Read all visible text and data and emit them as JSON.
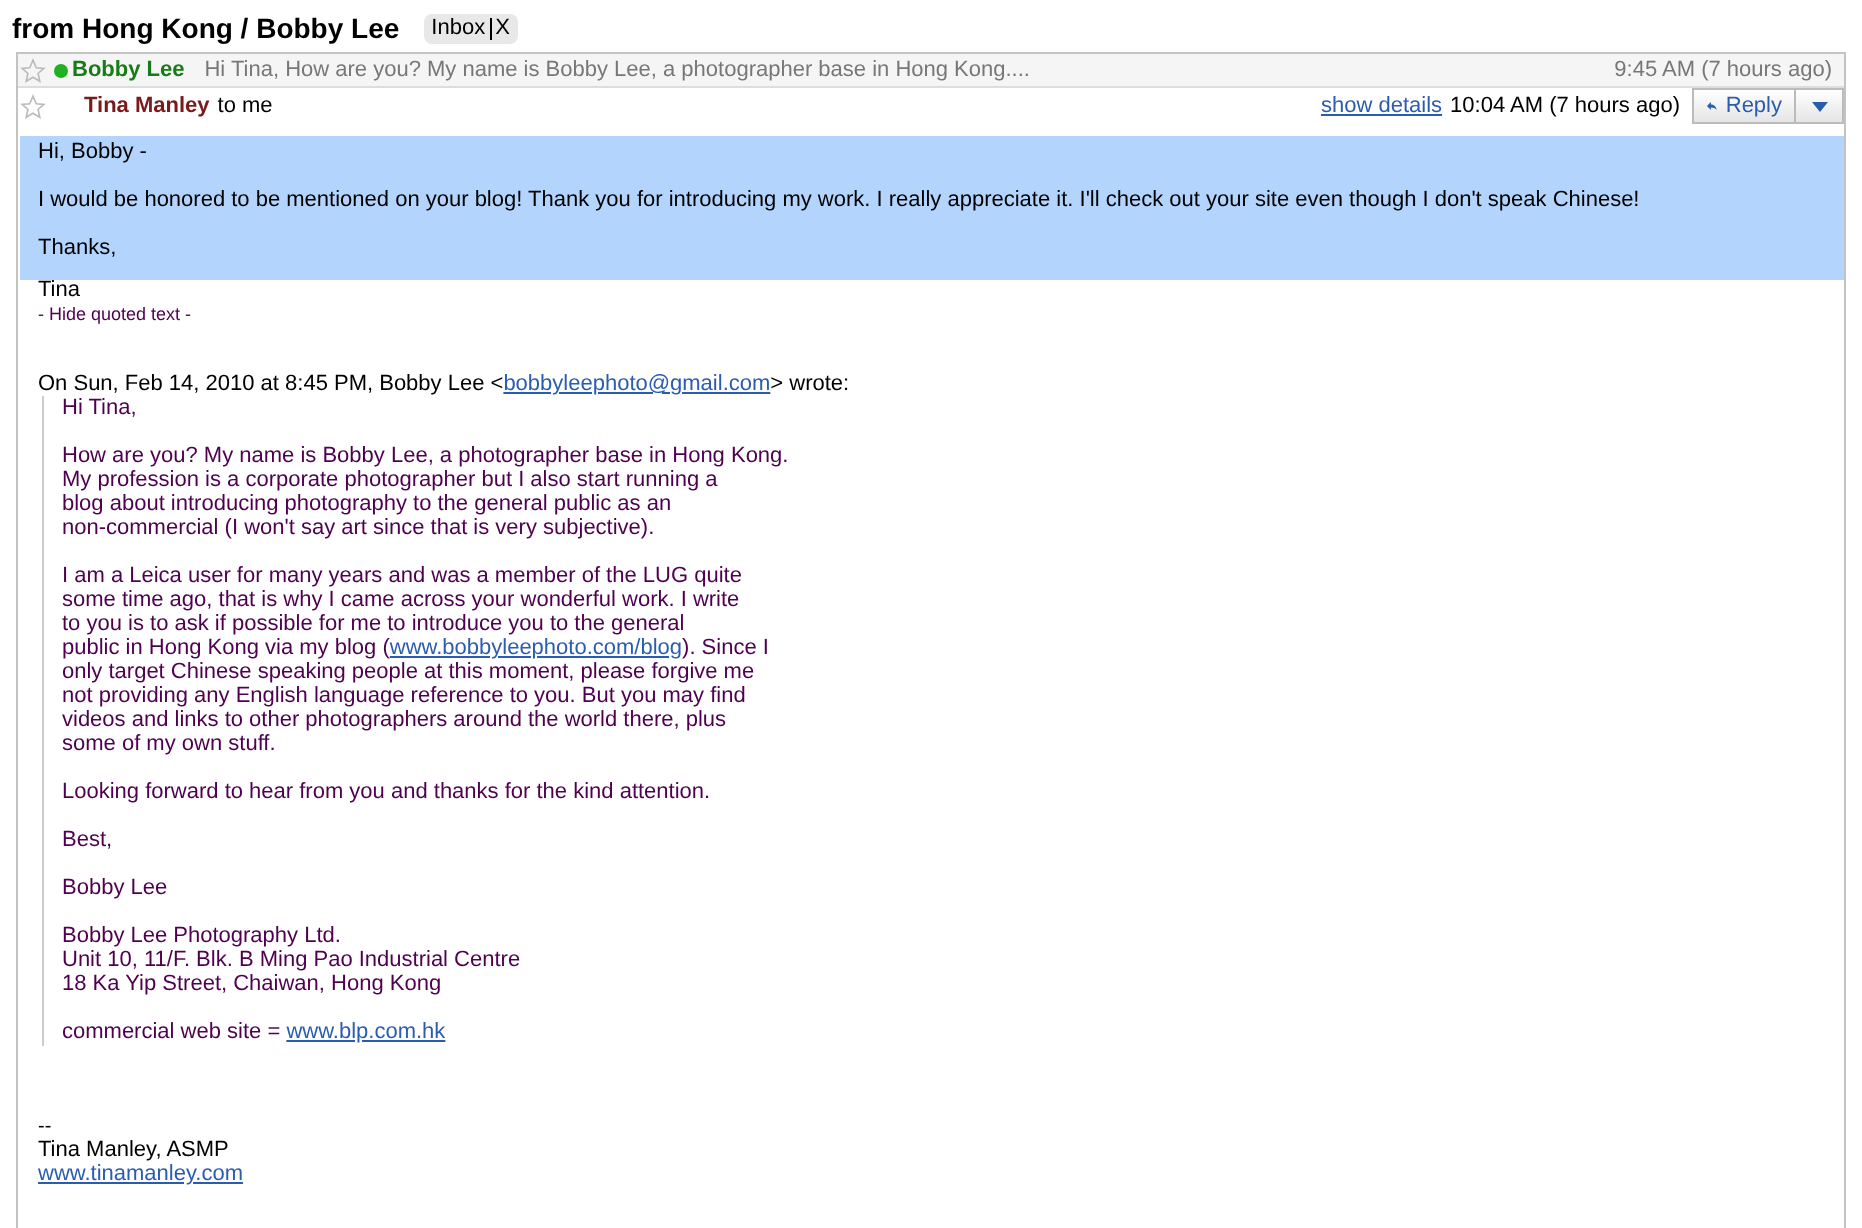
{
  "title": "from Hong Kong / Bobby Lee",
  "label": {
    "text": "Inbox",
    "remove": "X"
  },
  "collapsed_message": {
    "sender": "Bobby Lee",
    "snippet": "Hi Tina, How are you? My name is Bobby Lee, a photographer base in Hong Kong....",
    "time": "9:45 AM (7 hours ago)",
    "starred": false
  },
  "message": {
    "sender": "Tina Manley",
    "recipient": "to me",
    "show_details": "show details",
    "time": "10:04 AM (7 hours ago)",
    "reply": "Reply",
    "starred": false,
    "selected_lines": [
      "Hi, Bobby -",
      "I would be honored to be mentioned on your blog!  Thank you for introducing my work.  I really appreciate it.  I'll check out your site even though I don't speak Chinese!",
      "Thanks,"
    ],
    "signoff": "Tina",
    "hide_quoted": "- Hide quoted text -",
    "attribution": [
      {
        "text": "On Sun, Feb 14, 2010 at 8:45 PM, Bobby Lee <"
      },
      {
        "text": "bobbyleephoto@gmail.com",
        "link": true
      },
      {
        "text": "> wrote:"
      }
    ],
    "quoted_paragraphs": [
      {
        "lines": [
          [
            {
              "text": "Hi Tina,"
            }
          ]
        ]
      },
      {
        "lines": [
          [
            {
              "text": "How are you?  My name is Bobby Lee, a photographer base in Hong Kong."
            }
          ],
          [
            {
              "text": "My profession is a corporate photographer but I also start running a"
            }
          ],
          [
            {
              "text": "blog about introducing photography to the general public as an"
            }
          ],
          [
            {
              "text": "non-commercial (I won't say art since that is very subjective)."
            }
          ]
        ]
      },
      {
        "lines": [
          [
            {
              "text": "I am a Leica user for many years and was a member of the LUG quite"
            }
          ],
          [
            {
              "text": "some time ago, that is why I came across your wonderful work.  I write"
            }
          ],
          [
            {
              "text": "to you is to ask if possible for me to introduce you to the general"
            }
          ],
          [
            {
              "text": "public in Hong Kong via my blog ("
            },
            {
              "text": "www.bobbyleephoto.com/blog",
              "link": true
            },
            {
              "text": ").  Since I"
            }
          ],
          [
            {
              "text": "only target Chinese speaking people at this moment, please forgive me"
            }
          ],
          [
            {
              "text": "not providing any English language reference to you.  But you may find"
            }
          ],
          [
            {
              "text": "videos and links to other photographers around the world there, plus"
            }
          ],
          [
            {
              "text": "some of my own stuff."
            }
          ]
        ]
      },
      {
        "lines": [
          [
            {
              "text": "Looking forward to hear from you and thanks for the kind attention."
            }
          ]
        ]
      },
      {
        "lines": [
          [
            {
              "text": "Best,"
            }
          ]
        ]
      },
      {
        "lines": [
          [
            {
              "text": "Bobby Lee"
            }
          ]
        ]
      },
      {
        "lines": [
          [
            {
              "text": "Bobby Lee Photography Ltd."
            }
          ],
          [
            {
              "text": "Unit 10, 11/F. Blk. B Ming Pao Industrial Centre"
            }
          ],
          [
            {
              "text": "18 Ka Yip Street, Chaiwan, Hong Kong"
            }
          ]
        ]
      },
      {
        "lines": [
          [
            {
              "text": "commercial web site = "
            },
            {
              "text": "www.blp.com.hk",
              "link": true
            }
          ]
        ]
      }
    ],
    "signature": {
      "separator": "--",
      "name": "Tina Manley, ASMP",
      "link": "www.tinamanley.com"
    }
  }
}
